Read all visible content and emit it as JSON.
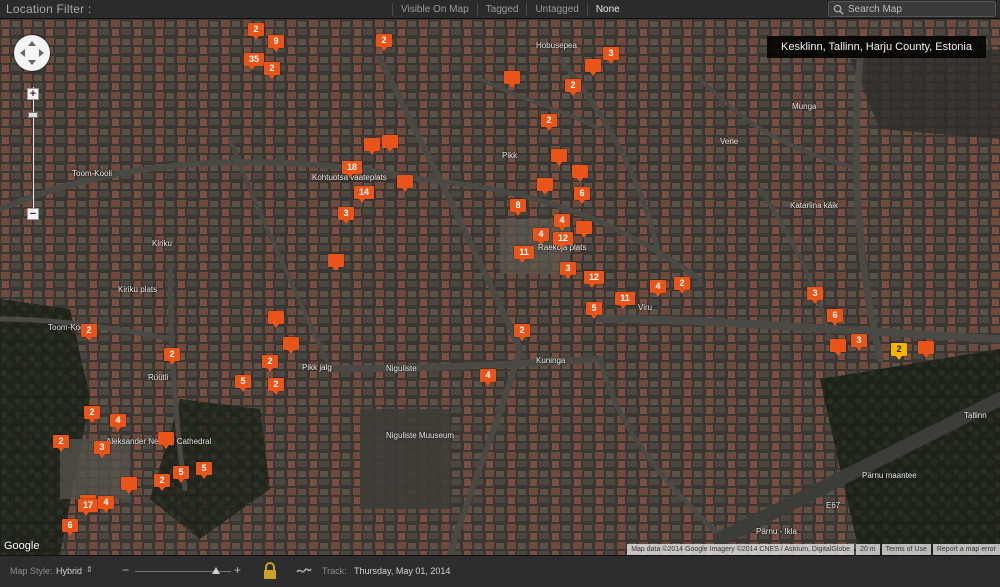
{
  "filter_bar": {
    "title": "Location Filter :",
    "options": [
      "Visible On Map",
      "Tagged",
      "Untagged",
      "None"
    ],
    "active_option": "None",
    "search_placeholder": "Search Map"
  },
  "map": {
    "location": "Kesklinn, Tallinn, Harju County, Estonia",
    "street_labels": [
      "Hobusepea",
      "Munga",
      "Pikk",
      "Toom-Kooli",
      "Kiriku",
      "Kiriku plats",
      "Toom-Kooli",
      "Pikk jalg",
      "Niguliste",
      "Kuninga",
      "Viru",
      "Katariina käik",
      "Vene",
      "Pärnu maantee",
      "Rüütli",
      "Raekoja plats",
      "Kohtuotsa vaateplats",
      "Niguliste Muuseum",
      "Aleksander Nevsky Cathedral",
      "Pärnu - Ikla",
      "Tallinn",
      "E67"
    ],
    "pins": [
      {
        "label": "2"
      },
      {
        "label": "9"
      },
      {
        "label": "35"
      },
      {
        "label": "2"
      },
      {
        "label": "2"
      },
      {
        "label": "3"
      },
      {
        "label": ""
      },
      {
        "label": "2"
      },
      {
        "label": ""
      },
      {
        "label": "2"
      },
      {
        "label": ""
      },
      {
        "label": ""
      },
      {
        "label": "18"
      },
      {
        "label": "14"
      },
      {
        "label": ""
      },
      {
        "label": "3"
      },
      {
        "label": ""
      },
      {
        "label": ""
      },
      {
        "label": ""
      },
      {
        "label": "6"
      },
      {
        "label": "8"
      },
      {
        "label": "4"
      },
      {
        "label": "4"
      },
      {
        "label": "12"
      },
      {
        "label": ""
      },
      {
        "label": "11"
      },
      {
        "label": "3"
      },
      {
        "label": "12"
      },
      {
        "label": "5"
      },
      {
        "label": "11"
      },
      {
        "label": "4"
      },
      {
        "label": "2"
      },
      {
        "label": "3"
      },
      {
        "label": "6"
      },
      {
        "label": ""
      },
      {
        "label": "3"
      },
      {
        "label": "2"
      },
      {
        "label": ""
      },
      {
        "label": ""
      },
      {
        "label": ""
      },
      {
        "label": "2"
      },
      {
        "label": "2"
      },
      {
        "label": "5"
      },
      {
        "label": "2"
      },
      {
        "label": ""
      },
      {
        "label": "2"
      },
      {
        "label": "4"
      },
      {
        "label": "2"
      },
      {
        "label": "3"
      },
      {
        "label": ""
      },
      {
        "label": "2"
      },
      {
        "label": "5"
      },
      {
        "label": "5"
      },
      {
        "label": ""
      },
      {
        "label": "17"
      },
      {
        "label": "4"
      },
      {
        "label": "6"
      },
      {
        "label": "4"
      },
      {
        "label": "2"
      }
    ],
    "attribution": [
      "Map data ©2014 Google Imagery ©2014 CNES / Astrium, DigitalGlobe",
      "20 m",
      "Terms of Use",
      "Report a map error"
    ],
    "google_logo": "Google"
  },
  "bottom_bar": {
    "map_style_label": "Map Style:",
    "map_style_value": "Hybrid",
    "zoom_minus": "−",
    "zoom_plus": "+",
    "track_label": "Track:",
    "track_value": "Thursday, May 01, 2014"
  },
  "colors": {
    "pin": "#e8541a",
    "pin_selected": "#f4b400"
  }
}
